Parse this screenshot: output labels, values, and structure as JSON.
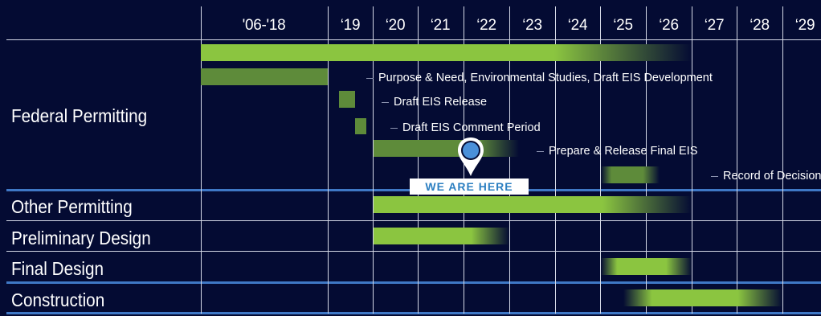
{
  "chart_data": {
    "type": "gantt",
    "x_ticks": [
      "'06-'18",
      "‘19",
      "‘20",
      "‘21",
      "‘22",
      "‘23",
      "‘24",
      "‘25",
      "‘26",
      "‘27",
      "‘28",
      "‘29"
    ],
    "marker_label": "WE ARE HERE",
    "marker_position": 2021.65,
    "rows": [
      {
        "label": "Federal Permitting",
        "bars": [
          {
            "start": 2006,
            "end": 2027.0,
            "fade_end": true,
            "shade": "light"
          },
          {
            "start": 2006,
            "end": 2019.0,
            "shade": "dark",
            "annotation": "Purpose & Need, Environmental Studies,  Draft EIS Development"
          },
          {
            "start": 2019.25,
            "end": 2019.6,
            "shade": "dark",
            "annotation": "Draft EIS Release"
          },
          {
            "start": 2019.6,
            "end": 2019.85,
            "shade": "dark",
            "annotation": "Draft EIS Comment Period"
          },
          {
            "start": 2020.0,
            "end": 2023.2,
            "fade_end": true,
            "shade": "dark",
            "annotation": "Prepare & Release Final EIS"
          },
          {
            "start": 2025.0,
            "end": 2026.3,
            "fade_both": true,
            "shade": "dark",
            "annotation": "Record of Decision"
          }
        ]
      },
      {
        "label": "Other Permitting",
        "bars": [
          {
            "start": 2020.0,
            "end": 2027.0,
            "fade_end": true,
            "shade": "light"
          }
        ]
      },
      {
        "label": "Preliminary Design",
        "bars": [
          {
            "start": 2020.0,
            "end": 2023.0,
            "fade_end": true,
            "shade": "light"
          }
        ]
      },
      {
        "label": "Final Design",
        "bars": [
          {
            "start": 2025.0,
            "end": 2027.0,
            "fade_both": true,
            "shade": "light"
          }
        ]
      },
      {
        "label": "Construction",
        "bars": [
          {
            "start": 2025.5,
            "end": 2029.0,
            "fade_both": true,
            "shade": "light"
          }
        ]
      }
    ],
    "colors": {
      "background": "#040b33",
      "bar_light": "#8bc540",
      "bar_dark": "#5e8b3a",
      "grid": "#d4d8e6",
      "separator": "#3f78c6",
      "marker": "#4a90d9"
    }
  }
}
